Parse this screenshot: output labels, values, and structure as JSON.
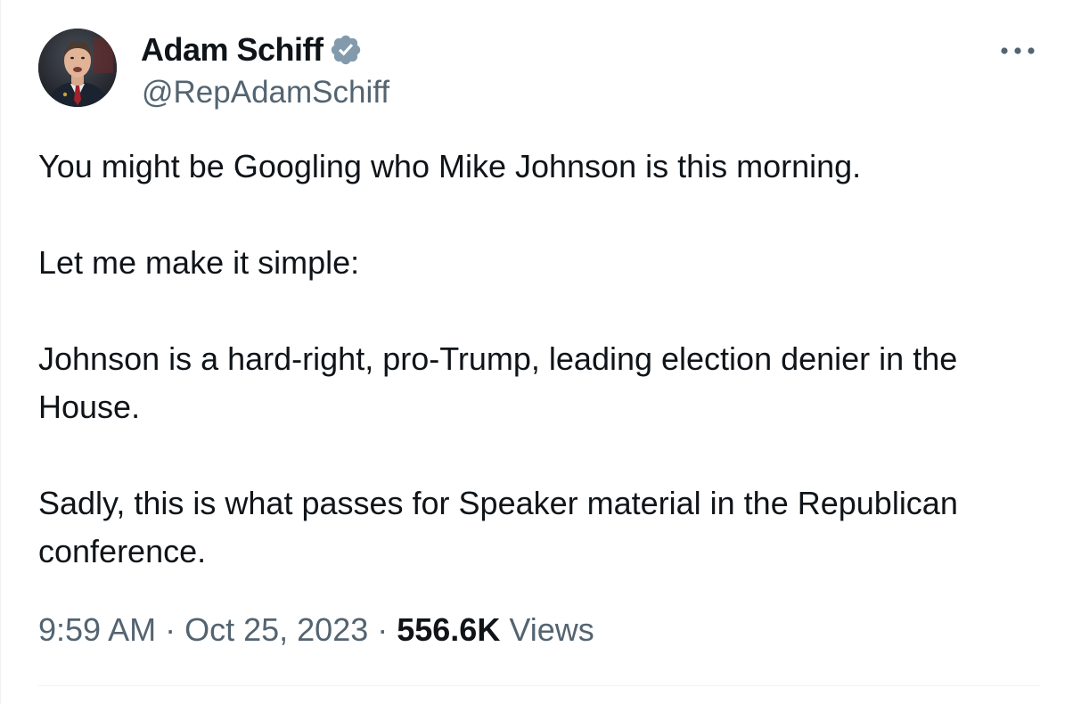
{
  "author": {
    "display_name": "Adam Schiff",
    "handle": "@RepAdamSchiff",
    "verified": true,
    "verified_color": "#829aab"
  },
  "tweet": {
    "paragraphs": [
      "You might be Googling who Mike Johnson is this morning.",
      "Let me make it simple:",
      "Johnson is a hard-right, pro-Trump, leading election denier in the House.",
      "Sadly, this is what passes for Speaker material in the Republican conference."
    ]
  },
  "meta": {
    "time": "9:59 AM",
    "separator": " · ",
    "date": "Oct 25, 2023",
    "views_count": "556.6K",
    "views_label": "Views"
  },
  "icons": {
    "verified": "verified-badge-icon",
    "more": "more-options-icon"
  },
  "colors": {
    "text_primary": "#0f1419",
    "text_secondary": "#536471",
    "divider": "#eff3f4"
  }
}
